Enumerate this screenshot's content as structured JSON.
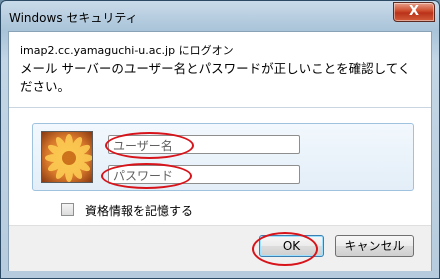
{
  "window": {
    "title": "Windows セキュリティ",
    "close_glyph": "X"
  },
  "dialog": {
    "host_line": "imap2.cc.yamaguchi-u.ac.jp にログオン",
    "message": "メール サーバーのユーザー名とパスワードが正しいことを確認してください。",
    "username_placeholder": "ユーザー名",
    "password_placeholder": "パスワード",
    "remember_label": "資格情報を記憶する",
    "remember_checked": false
  },
  "buttons": {
    "ok": "OK",
    "cancel": "キャンセル"
  },
  "colors": {
    "annotation_red": "#d8141b",
    "panel_border": "#9fc2df",
    "close_red": "#cc4a2b"
  },
  "icons": {
    "avatar": "orange-flower-avatar-icon",
    "close": "close-icon"
  }
}
